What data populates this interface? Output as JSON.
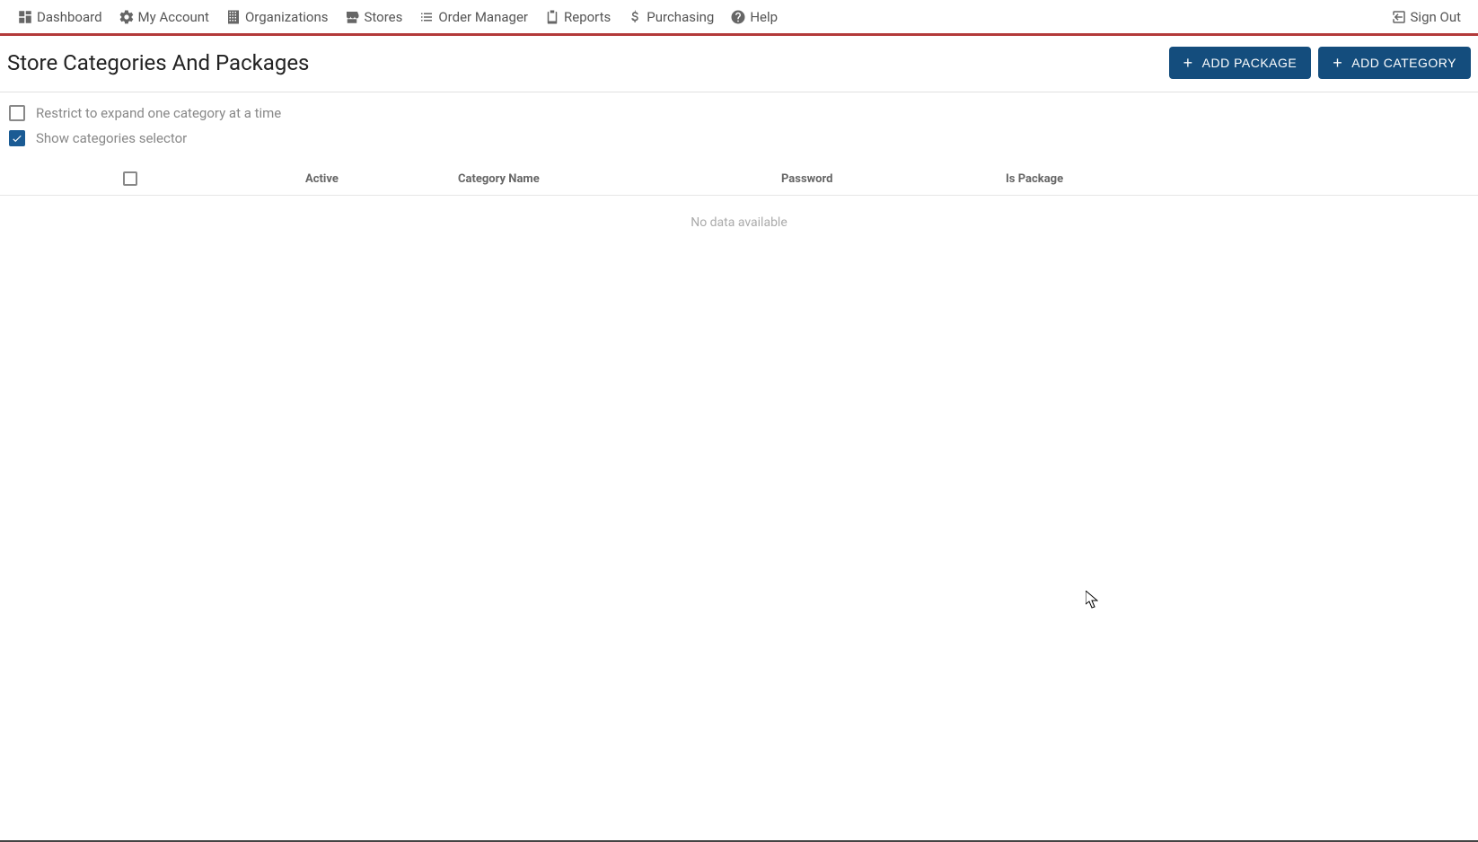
{
  "nav": {
    "dashboard": "Dashboard",
    "my_account": "My Account",
    "organizations": "Organizations",
    "stores": "Stores",
    "order_manager": "Order Manager",
    "reports": "Reports",
    "purchasing": "Purchasing",
    "help": "Help",
    "sign_out": "Sign Out"
  },
  "page": {
    "title": "Store Categories And Packages"
  },
  "buttons": {
    "add_package": "Add Package",
    "add_category": "Add Category"
  },
  "options": {
    "restrict_expand": {
      "label": "Restrict to expand one category at a time",
      "checked": false
    },
    "show_selector": {
      "label": "Show categories selector",
      "checked": true
    }
  },
  "table": {
    "columns": {
      "active": "Active",
      "category_name": "Category Name",
      "password": "Password",
      "is_package": "Is Package"
    },
    "no_data": "No data available",
    "rows": []
  }
}
